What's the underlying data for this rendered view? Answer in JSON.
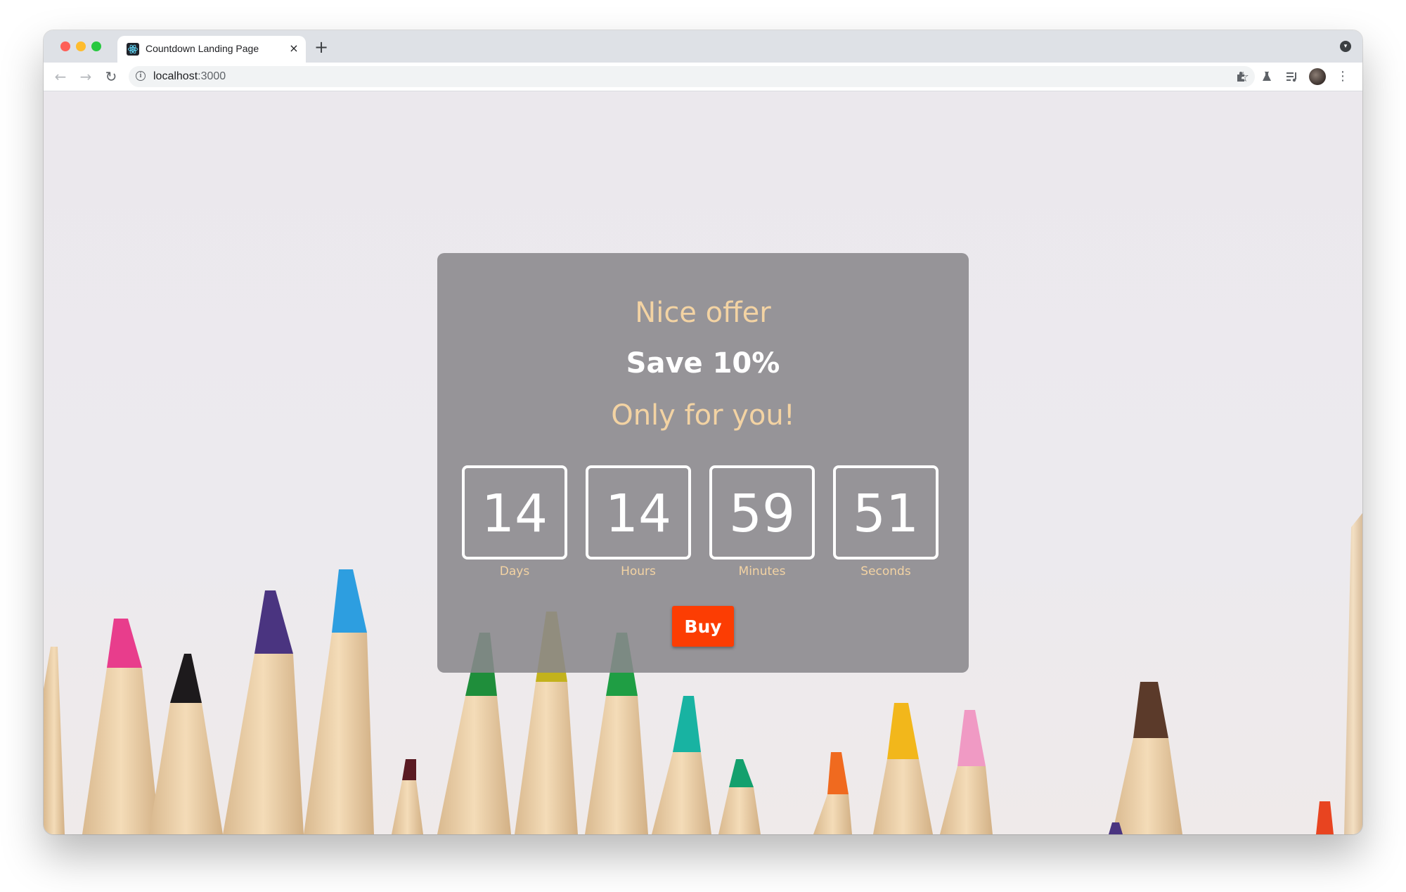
{
  "browser": {
    "tab_title": "Countdown Landing Page",
    "tab_close_glyph": "×",
    "new_tab_glyph": "+",
    "url_host": "localhost",
    "url_port": ":3000"
  },
  "offer": {
    "line1": "Nice offer",
    "line2": "Save 10%",
    "line3": "Only for you!"
  },
  "countdown": [
    {
      "value": "14",
      "label": "Days"
    },
    {
      "value": "14",
      "label": "Hours"
    },
    {
      "value": "59",
      "label": "Minutes"
    },
    {
      "value": "51",
      "label": "Seconds"
    }
  ],
  "buy_label": "Buy",
  "colors": {
    "accent_text": "#f3d3a3",
    "buy_button": "#fc3d03",
    "card_bg": "#8a888c"
  },
  "icons": {
    "favicon": "react-icon",
    "back": "arrow-left-icon",
    "forward": "arrow-right-icon",
    "reload": "reload-icon",
    "info": "info-icon",
    "bookmark": "star-icon",
    "extensions": "puzzle-icon",
    "labs": "flask-icon",
    "media": "media-list-icon",
    "profile": "avatar",
    "menu": "more-vert-icon"
  }
}
